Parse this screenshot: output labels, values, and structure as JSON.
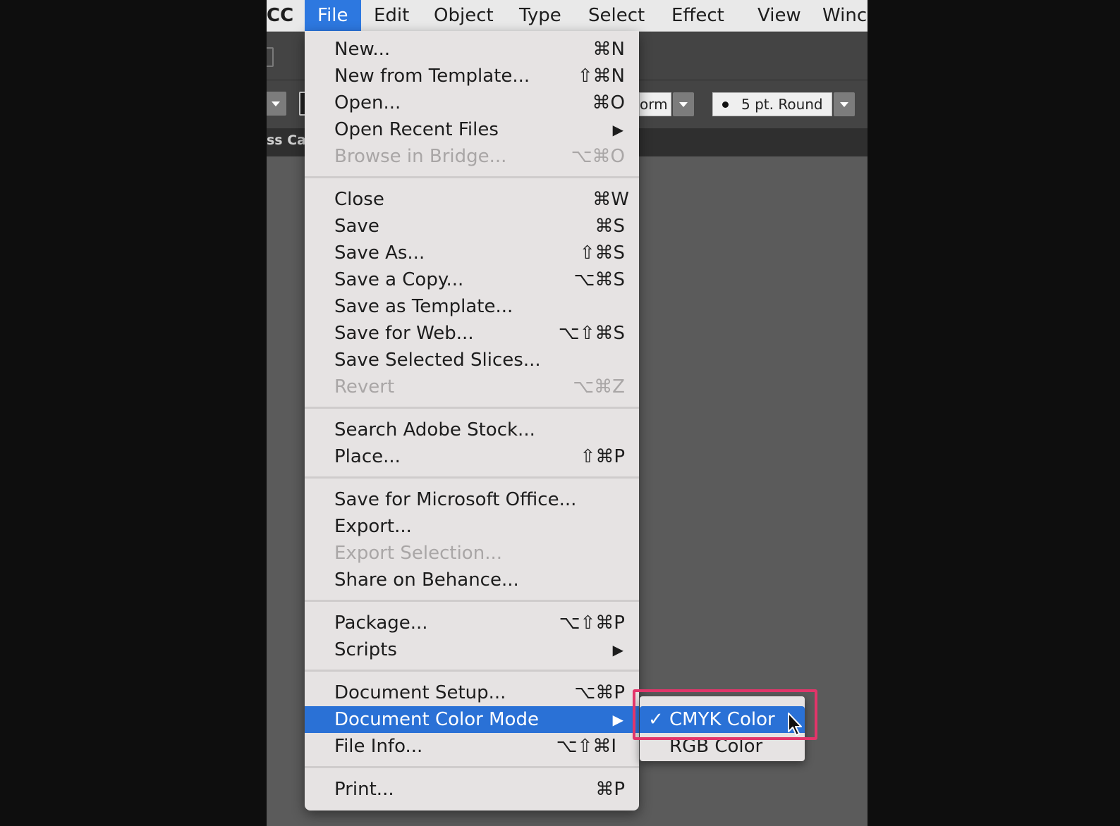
{
  "menubar": {
    "items": [
      {
        "label": "CC"
      },
      {
        "label": "File"
      },
      {
        "label": "Edit"
      },
      {
        "label": "Object"
      },
      {
        "label": "Type"
      },
      {
        "label": "Select"
      },
      {
        "label": "Effect"
      },
      {
        "label": "View"
      },
      {
        "label": "Winc"
      }
    ]
  },
  "toolbar": {
    "transform_field": "orm",
    "brush_field": "5 pt. Round"
  },
  "tab": {
    "label": "ss Ca"
  },
  "file_menu": {
    "items": [
      {
        "label": "New...",
        "shortcut": "⌘N"
      },
      {
        "label": "New from Template...",
        "shortcut": "⇧⌘N"
      },
      {
        "label": "Open...",
        "shortcut": "⌘O"
      },
      {
        "label": "Open Recent Files",
        "shortcut": "▶"
      },
      {
        "label": "Browse in Bridge...",
        "shortcut": "⌥⌘O"
      },
      {
        "label": "Close",
        "shortcut": "⌘W"
      },
      {
        "label": "Save",
        "shortcut": "⌘S"
      },
      {
        "label": "Save As...",
        "shortcut": "⇧⌘S"
      },
      {
        "label": "Save a Copy...",
        "shortcut": "⌥⌘S"
      },
      {
        "label": "Save as Template...",
        "shortcut": ""
      },
      {
        "label": "Save for Web...",
        "shortcut": "⌥⇧⌘S"
      },
      {
        "label": "Save Selected Slices...",
        "shortcut": ""
      },
      {
        "label": "Revert",
        "shortcut": "⌥⌘Z"
      },
      {
        "label": "Search Adobe Stock...",
        "shortcut": ""
      },
      {
        "label": "Place...",
        "shortcut": "⇧⌘P"
      },
      {
        "label": "Save for Microsoft Office...",
        "shortcut": ""
      },
      {
        "label": "Export...",
        "shortcut": ""
      },
      {
        "label": "Export Selection...",
        "shortcut": ""
      },
      {
        "label": "Share on Behance...",
        "shortcut": ""
      },
      {
        "label": "Package...",
        "shortcut": "⌥⇧⌘P"
      },
      {
        "label": "Scripts",
        "shortcut": "▶"
      },
      {
        "label": "Document Setup...",
        "shortcut": "⌥⌘P"
      },
      {
        "label": "Document Color Mode",
        "shortcut": "▶"
      },
      {
        "label": "File Info...",
        "shortcut": "⌥⇧⌘I"
      },
      {
        "label": "Print...",
        "shortcut": "⌘P"
      }
    ]
  },
  "submenu": {
    "items": [
      {
        "label": "CMYK Color",
        "check": "✓"
      },
      {
        "label": "RGB Color"
      }
    ]
  },
  "colors": {
    "highlight": "#2a71d6",
    "annotation_box": "#e2356a",
    "menu_bg": "#e6e3e3"
  }
}
